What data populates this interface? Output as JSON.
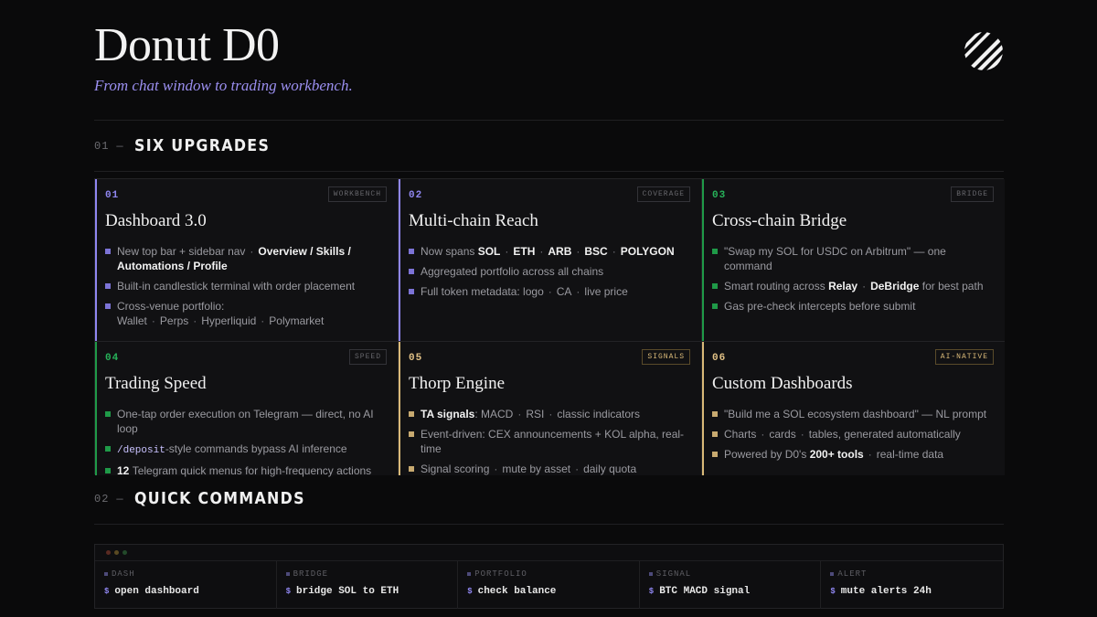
{
  "header": {
    "title": "Donut D0",
    "subtitle": "From chat window to trading workbench.",
    "logo_icon": "striped-circle-logo"
  },
  "sections": [
    {
      "num": "01",
      "dash": "—",
      "title": "SIX UPGRADES"
    },
    {
      "num": "02",
      "dash": "—",
      "title": "QUICK COMMANDS"
    }
  ],
  "colors": {
    "purple": "#8f86f0",
    "green": "#1f9a48",
    "amber": "#d9b978"
  },
  "cards": [
    {
      "num": "01",
      "tag": "WORKBENCH",
      "title": "Dashboard 3.0",
      "items": [
        {
          "a": "New top bar + sidebar nav",
          "b": "·",
          "c": "Overview / Skills / Automations / Profile"
        },
        {
          "a": "Built-in candlestick terminal with order placement"
        },
        {
          "a": "Cross-venue portfolio: Wallet",
          "b": "·",
          "c": "Perps",
          "d": "·",
          "e": "Hyperliquid",
          "f": "·",
          "g": "Polymarket"
        }
      ]
    },
    {
      "num": "02",
      "tag": "COVERAGE",
      "title": "Multi-chain Reach",
      "items": [
        {
          "a": "Now spans",
          "chains": [
            "SOL",
            "ETH",
            "ARB",
            "BSC",
            "POLYGON"
          ],
          "sep": "·"
        },
        {
          "a": "Aggregated portfolio across all chains"
        },
        {
          "a": "Full token metadata: logo",
          "b": "·",
          "c": "CA",
          "d": "·",
          "e": "live price"
        }
      ]
    },
    {
      "num": "03",
      "tag": "BRIDGE",
      "title": "Cross-chain Bridge",
      "items": [
        {
          "a": "\"Swap my SOL for USDC on Arbitrum\" — one command"
        },
        {
          "a": "Smart routing across",
          "b": "Relay",
          "c": "·",
          "d": "DeBridge",
          "e": "for best path"
        },
        {
          "a": "Gas pre-check intercepts before submit"
        }
      ]
    },
    {
      "num": "04",
      "tag": "SPEED",
      "title": "Trading Speed",
      "items": [
        {
          "a": "One-tap order execution on Telegram — direct, no AI loop"
        },
        {
          "code": "/deposit",
          "a": "-style commands bypass AI inference"
        },
        {
          "b": "12",
          "a": "Telegram quick menus for high-frequency actions"
        }
      ]
    },
    {
      "num": "05",
      "tag": "SIGNALS",
      "title": "Thorp Engine",
      "items": [
        {
          "b": "TA signals",
          "a": ": MACD",
          "c": "·",
          "d": "RSI",
          "e": "·",
          "f": "classic indicators"
        },
        {
          "a": "Event-driven: CEX announcements + KOL alpha, real-time"
        },
        {
          "a": "Signal scoring",
          "b": "·",
          "c": "mute by asset",
          "d": "·",
          "e": "daily quota"
        }
      ]
    },
    {
      "num": "06",
      "tag": "AI-NATIVE",
      "title": "Custom Dashboards",
      "items": [
        {
          "a": "\"Build me a SOL ecosystem dashboard\" — NL prompt"
        },
        {
          "a": "Charts",
          "b": "·",
          "c": "cards",
          "d": "·",
          "e": "tables, generated automatically"
        },
        {
          "a": "Powered by D0's",
          "b": "200+ tools",
          "c": "·",
          "d": "real-time data"
        }
      ]
    }
  ],
  "terminal": {
    "dot_colors": [
      "#5a2a22",
      "#5a4a22",
      "#234a2a"
    ],
    "prompt": "$",
    "commands": [
      {
        "label": "DASH",
        "text": "open dashboard"
      },
      {
        "label": "BRIDGE",
        "text": "bridge SOL to ETH"
      },
      {
        "label": "PORTFOLIO",
        "text": "check balance"
      },
      {
        "label": "SIGNAL",
        "text": "BTC MACD signal"
      },
      {
        "label": "ALERT",
        "text": "mute alerts 24h"
      }
    ]
  }
}
